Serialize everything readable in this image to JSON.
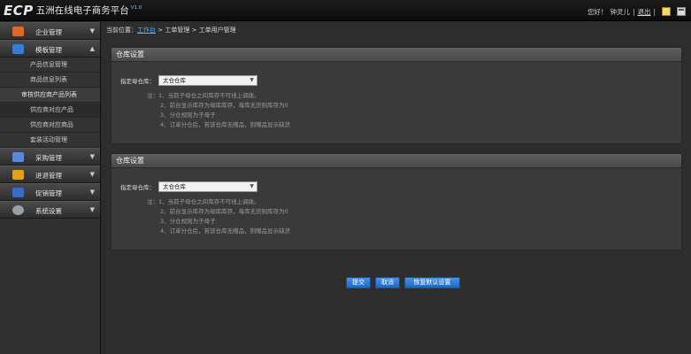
{
  "header": {
    "logo": "ECP",
    "title": "五洲在线电子商务平台",
    "version": "V1.0",
    "greeting": "您好！",
    "username": "钟灵儿",
    "logout": "退出",
    "separator": "|"
  },
  "sidebar": {
    "groups": [
      {
        "label": "企业管理",
        "icon": "building-icon",
        "chevron": "▼",
        "color": "#d96a2b"
      },
      {
        "label": "模板管理",
        "icon": "template-icon",
        "chevron": "▲",
        "color": "#3a7bd5"
      },
      {
        "label": "采购管理",
        "icon": "purchase-icon",
        "chevron": "▼",
        "color": "#5a8ad6"
      },
      {
        "label": "进退管理",
        "icon": "transfer-icon",
        "chevron": "▼",
        "color": "#e0a020"
      },
      {
        "label": "促销管理",
        "icon": "promotion-icon",
        "chevron": "▼",
        "color": "#3b6bc4"
      },
      {
        "label": "系统设置",
        "icon": "settings-gear-icon",
        "chevron": "▼",
        "color": "#9aa0aa"
      }
    ],
    "sub_items": [
      "产品信息管理",
      "商品信息列表",
      "审核供应商产品列表",
      "供应商对应产品",
      "供应商对应商品",
      "套装活动管理"
    ]
  },
  "breadcrumb": {
    "prefix": "当前位置：",
    "home": "工作台",
    "sep": ">",
    "level2": "工单管理",
    "level3": "工单用户管理"
  },
  "panels": [
    {
      "title": "仓库设置",
      "label": "指定母仓库：",
      "selected": "太仓仓库",
      "notes": [
        "注：1、当前子母仓之间库存不可线上调拨。",
        "2、前台显示库存为母库库存，母库无货则库存为0",
        "3、分仓规则为子母子",
        "4、订单分仓后，若该仓库无赠品，则赠品显示缺货"
      ]
    },
    {
      "title": "仓库设置",
      "label": "指定母仓库：",
      "selected": "太仓仓库",
      "notes": [
        "注：1、当前子母仓之间库存不可线上调拨。",
        "2、前台显示库存为母库库存，母库无货则库存为0",
        "3、分仓规则为子母子",
        "4、订单分仓后，若该仓库无赠品，则赠品显示缺货"
      ]
    }
  ],
  "buttons": {
    "submit": "提交",
    "cancel": "取消",
    "restore": "恢复默认设置"
  },
  "colors": {
    "accent": "#2f7fd6",
    "link": "#5aa8ff"
  }
}
